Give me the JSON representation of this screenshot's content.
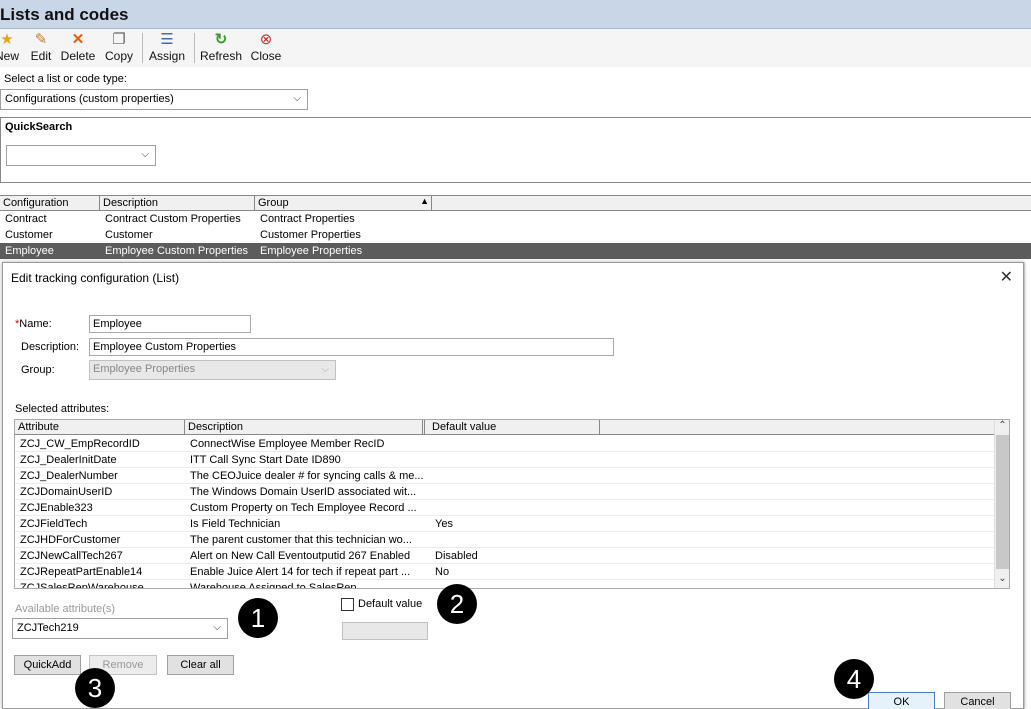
{
  "app": {
    "title": "Lists and codes"
  },
  "toolbar": {
    "new": "New",
    "edit": "Edit",
    "delete": "Delete",
    "copy": "Copy",
    "assign": "Assign",
    "refresh": "Refresh",
    "close": "Close"
  },
  "type_select": {
    "label": "Select a list or code type:",
    "value": "Configurations (custom properties)"
  },
  "quicksearch": {
    "title": "QuickSearch",
    "value": ""
  },
  "main_grid": {
    "columns": [
      "Configuration",
      "Description",
      "Group"
    ],
    "rows": [
      [
        "Contract",
        "Contract Custom Properties",
        "Contract Properties"
      ],
      [
        "Customer",
        "Customer",
        "Customer Properties"
      ],
      [
        "Employee",
        "Employee Custom Properties",
        "Employee Properties"
      ]
    ],
    "selected_row": 2
  },
  "dialog": {
    "title": "Edit tracking configuration (List)",
    "close_glyph": "✕",
    "name_required_mark": "*",
    "name_label": "Name:",
    "name_value": "Employee",
    "description_label": "Description:",
    "description_value": "Employee Custom Properties",
    "group_label": "Group:",
    "group_value": "Employee Properties",
    "selected_attributes_label": "Selected attributes:",
    "attr_columns": [
      "Attribute",
      "Description",
      "Default value"
    ],
    "attr_rows": [
      [
        "ZCJ_CW_EmpRecordID",
        "ConnectWise Employee Member RecID",
        ""
      ],
      [
        "ZCJ_DealerInitDate",
        "ITT Call Sync Start Date ID890",
        ""
      ],
      [
        "ZCJ_DealerNumber",
        "The CEOJuice dealer # for syncing calls & me...",
        ""
      ],
      [
        "ZCJDomainUserID",
        "The Windows Domain UserID associated wit...",
        ""
      ],
      [
        "ZCJEnable323",
        "Custom Property on Tech Employee Record ...",
        ""
      ],
      [
        "ZCJFieldTech",
        "Is Field Technician",
        "Yes"
      ],
      [
        "ZCJHDForCustomer",
        "The parent customer that this technician wo...",
        ""
      ],
      [
        "ZCJNewCallTech267",
        "Alert on New Call Eventoutputid 267 Enabled",
        "Disabled"
      ],
      [
        "ZCJRepeatPartEnable14",
        "Enable Juice Alert 14 for tech if repeat part ...",
        "No"
      ],
      [
        "ZCJSalesRepWarehouse",
        "Warehouse Assigned to SalesRep",
        ""
      ]
    ],
    "available_label": "Available attribute(s)",
    "available_value": "ZCJTech219",
    "default_value_label": "Default value",
    "default_value_input": "",
    "quickadd": "QuickAdd",
    "remove": "Remove",
    "clear_all": "Clear all",
    "ok": "OK",
    "cancel": "Cancel"
  },
  "badges": [
    "1",
    "2",
    "3",
    "4"
  ]
}
